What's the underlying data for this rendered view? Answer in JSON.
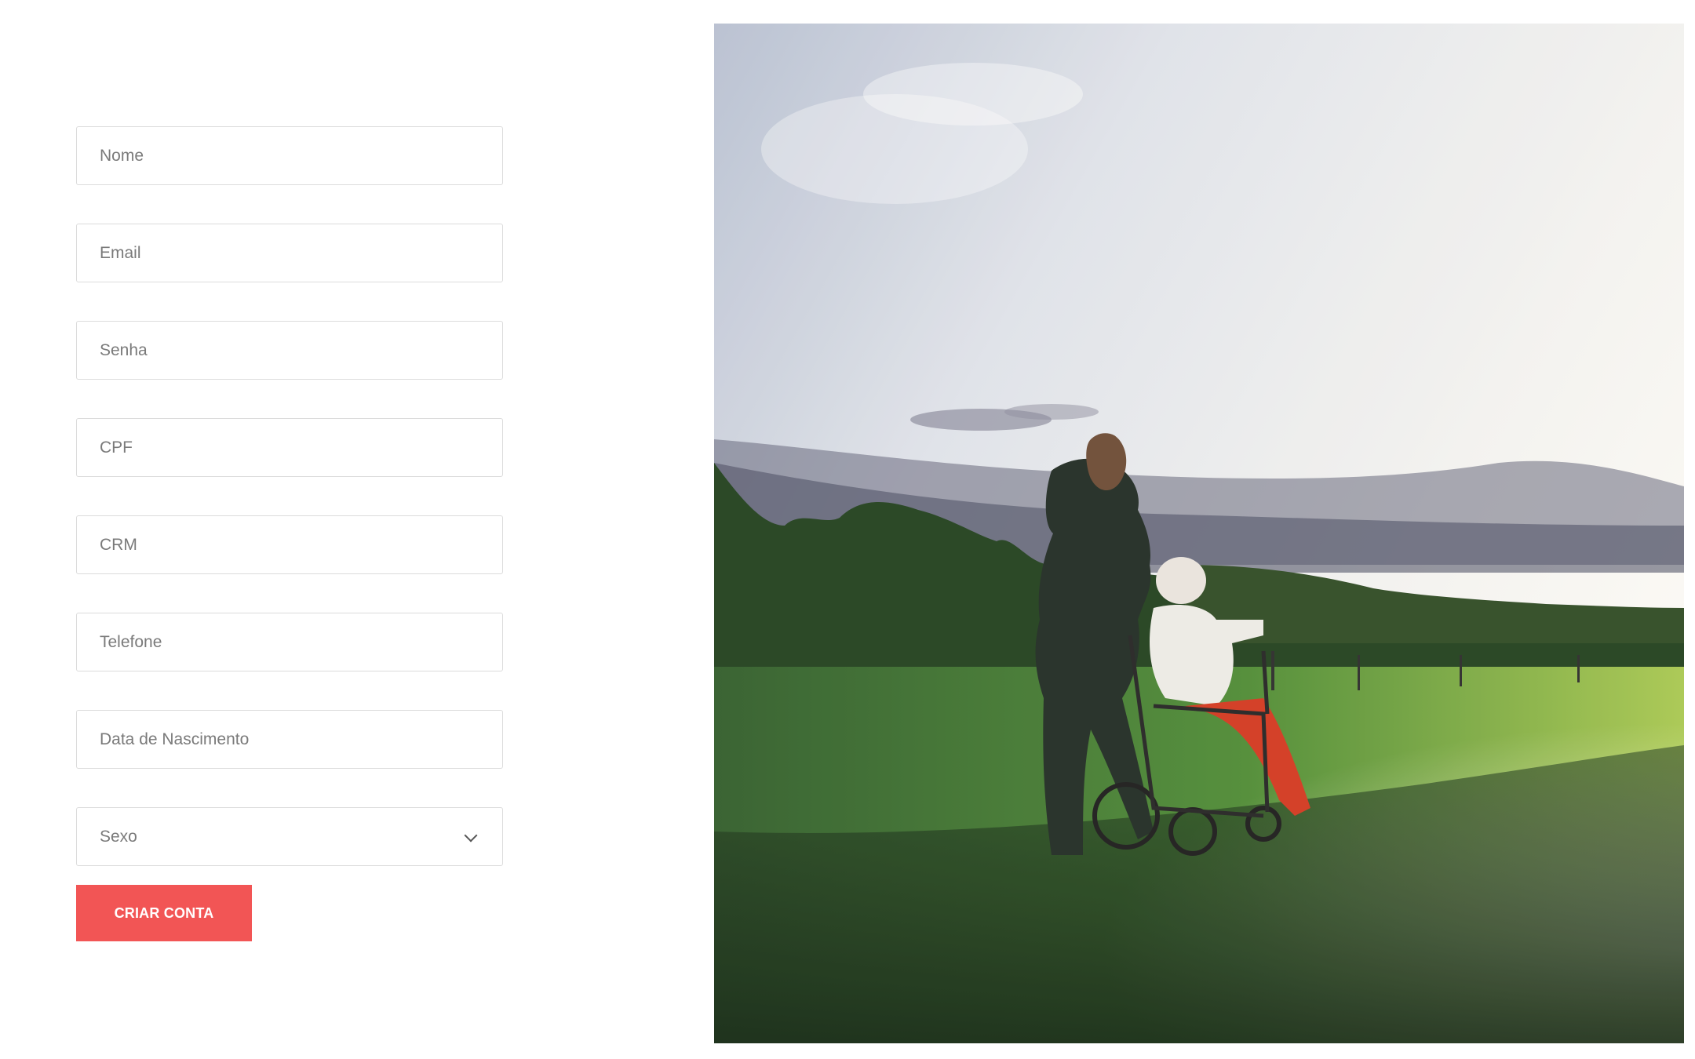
{
  "form": {
    "fields": [
      {
        "placeholder": "Nome"
      },
      {
        "placeholder": "Email"
      },
      {
        "placeholder": "Senha"
      },
      {
        "placeholder": "CPF"
      },
      {
        "placeholder": "CRM"
      },
      {
        "placeholder": "Telefone"
      },
      {
        "placeholder": "Data de Nascimento"
      }
    ],
    "gender_select": {
      "value": "Sexo",
      "icon": "chevron-down-icon"
    },
    "submit_label": "CRIAR CONTA"
  },
  "colors": {
    "accent": "#f25555",
    "field_border": "#dcdcdc",
    "placeholder": "#7a7a7a"
  }
}
